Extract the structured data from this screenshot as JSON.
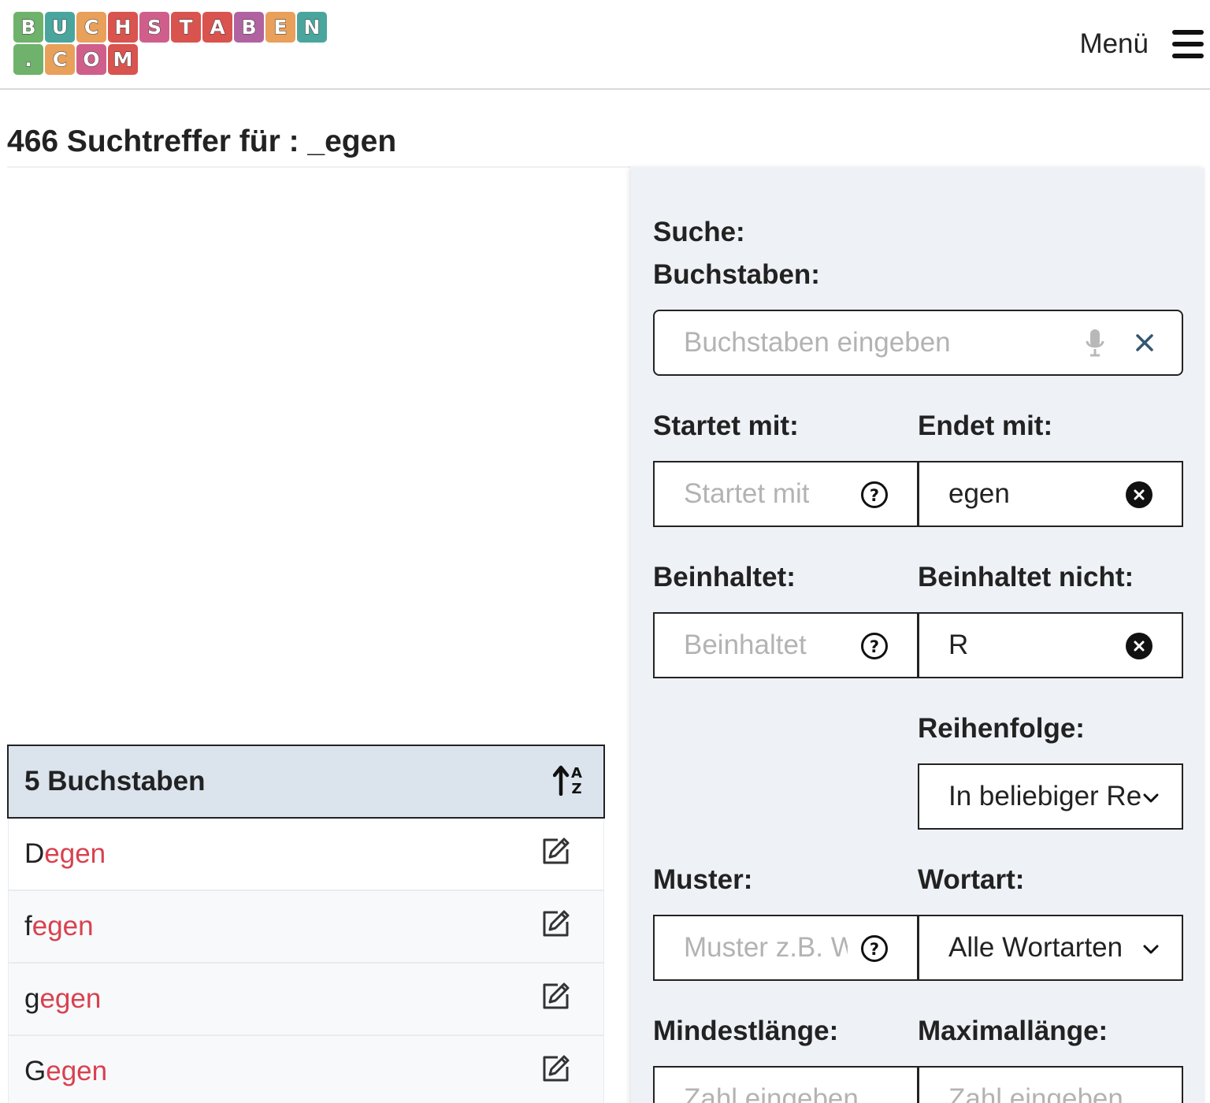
{
  "header": {
    "logo": {
      "row1": [
        "B",
        "U",
        "C",
        "H",
        "S",
        "T",
        "A",
        "B",
        "E",
        "N"
      ],
      "row2": [
        ".",
        "C",
        "O",
        "M"
      ]
    },
    "menu_label": "Menü"
  },
  "title": "466 Suchtreffer für : _egen",
  "results": {
    "group_title": "5 Buchstaben",
    "words": [
      {
        "head": "D",
        "tail": "egen"
      },
      {
        "head": "f",
        "tail": "egen"
      },
      {
        "head": "g",
        "tail": "egen"
      },
      {
        "head": "G",
        "tail": "egen"
      }
    ]
  },
  "sidebar": {
    "search_label": "Suche:",
    "letters_label": "Buchstaben:",
    "letters_placeholder": "Buchstaben eingeben",
    "starts_label": "Startet mit:",
    "starts_placeholder": "Startet mit",
    "ends_label": "Endet mit:",
    "ends_value": "egen",
    "contains_label": "Beinhaltet:",
    "contains_placeholder": "Beinhaltet",
    "excludes_label": "Beinhaltet nicht:",
    "excludes_value": "R",
    "order_label": "Reihenfolge:",
    "order_value": "In beliebiger Re",
    "pattern_label": "Muster:",
    "pattern_placeholder": "Muster z.B. W",
    "wordtype_label": "Wortart:",
    "wordtype_value": "Alle Wortarten",
    "minlen_label": "Mindestlänge:",
    "minlen_placeholder": "Zahl eingeben",
    "maxlen_label": "Maximallänge:",
    "maxlen_placeholder": "Zahl eingeben"
  },
  "colors": {
    "accent_red": "#d9414f",
    "list_header_bg": "#dbe4ed",
    "sidebar_bg": "#eef1f5"
  },
  "icons": [
    "microphone-icon",
    "close-icon",
    "help-circle-icon",
    "clear-circle-icon",
    "chevron-down-icon",
    "sort-alpha-icon",
    "edit-icon",
    "hamburger-menu-icon"
  ]
}
